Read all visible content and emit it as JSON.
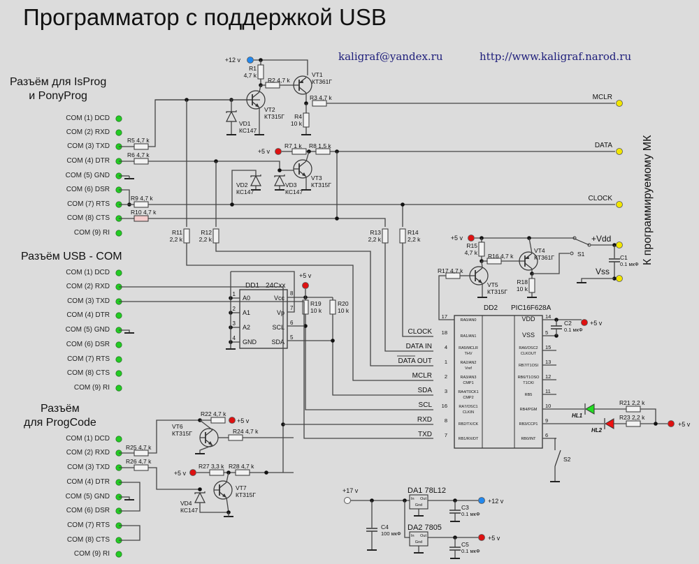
{
  "title": "Программатор с поддержкой USB",
  "email": "kaligraf@yandex.ru",
  "website": "http://www.kaligraf.narod.ru",
  "side_label": "К программируемому МК",
  "connectors": [
    {
      "id": "isprog",
      "title_lines": [
        "Разъём для IsProg",
        "и PonyProg"
      ],
      "pins": [
        "COM (1) DCD",
        "COM (2) RXD",
        "COM (3) TXD",
        "COM (4) DTR",
        "COM (5) GND",
        "COM (6) DSR",
        "COM (7) RTS",
        "COM (8) CTS",
        "COM (9) RI"
      ]
    },
    {
      "id": "usbcom",
      "title_lines": [
        "Разъём USB - COM"
      ],
      "pins": [
        "COM (1) DCD",
        "COM (2) RXD",
        "COM (3) TXD",
        "COM (4) DTR",
        "COM (5) GND",
        "COM (6) DSR",
        "COM (7) RTS",
        "COM (8) CTS",
        "COM (9) RI"
      ]
    },
    {
      "id": "progcode",
      "title_lines": [
        "Разъём",
        "для ProgCode"
      ],
      "pins": [
        "COM (1) DCD",
        "COM (2) RXD",
        "COM (3) TXD",
        "COM (4) DTR",
        "COM (5) GND",
        "COM (6) DSR",
        "COM (7) RTS",
        "COM (8) CTS",
        "COM (9) RI"
      ]
    }
  ],
  "outputs": {
    "mclr": "MCLR",
    "data": "DATA",
    "clock": "CLOCK",
    "vdd": "+Vdd",
    "vss": "Vss"
  },
  "power": {
    "p12": "+12 v",
    "p5": "+5 v",
    "p17": "+17 v"
  },
  "components": {
    "R1": {
      "name": "R1",
      "value": "4,7 k"
    },
    "R2": {
      "name": "R2",
      "value": "4,7 k"
    },
    "R3": {
      "name": "R3",
      "value": "4,7 k"
    },
    "R4": {
      "name": "R4",
      "value": "10 k"
    },
    "R5": {
      "name": "R5",
      "value": "4,7 k"
    },
    "R6": {
      "name": "R6",
      "value": "4,7 k"
    },
    "R7": {
      "name": "R7",
      "value": "1 k"
    },
    "R8": {
      "name": "R8",
      "value": "1,5 k"
    },
    "R9": {
      "name": "R9",
      "value": "4,7 k"
    },
    "R10": {
      "name": "R10",
      "value": "4,7 k"
    },
    "R11": {
      "name": "R11",
      "value": "2,2 k"
    },
    "R12": {
      "name": "R12",
      "value": "2,2 k"
    },
    "R13": {
      "name": "R13",
      "value": "2,2 k"
    },
    "R14": {
      "name": "R14",
      "value": "2,2 k"
    },
    "R15": {
      "name": "R15",
      "value": "4,7 k"
    },
    "R16": {
      "name": "R16",
      "value": "4,7 k"
    },
    "R17": {
      "name": "R17",
      "value": "4,7 k"
    },
    "R18": {
      "name": "R18",
      "value": "10 k"
    },
    "R19": {
      "name": "R19",
      "value": "10 k"
    },
    "R20": {
      "name": "R20",
      "value": "10 k"
    },
    "R21": {
      "name": "R21",
      "value": "2,2 k"
    },
    "R22": {
      "name": "R22",
      "value": "4,7 k"
    },
    "R23": {
      "name": "R23",
      "value": "2,2 k"
    },
    "R24": {
      "name": "R24",
      "value": "4,7 k"
    },
    "R25": {
      "name": "R25",
      "value": "4,7 k"
    },
    "R26": {
      "name": "R26",
      "value": "4,7 k"
    },
    "R27": {
      "name": "R27",
      "value": "3,3 k"
    },
    "R28": {
      "name": "R28",
      "value": "4,7 k"
    },
    "VT1": {
      "name": "VT1",
      "value": "КТ361Г"
    },
    "VT2": {
      "name": "VT2",
      "value": "КТ315Г"
    },
    "VT3": {
      "name": "VT3",
      "value": "КТ315Г"
    },
    "VT4": {
      "name": "VT4",
      "value": "КТ361Г"
    },
    "VT5": {
      "name": "VT5",
      "value": "КТ315Г"
    },
    "VT6": {
      "name": "VT6",
      "value": "КТ315Г"
    },
    "VT7": {
      "name": "VT7",
      "value": "КТ315Г"
    },
    "VD1": {
      "name": "VD1",
      "value": "КС147"
    },
    "VD2": {
      "name": "VD2",
      "value": "КС147"
    },
    "VD3": {
      "name": "VD3",
      "value": "КС147"
    },
    "VD4": {
      "name": "VD4",
      "value": "КС147"
    },
    "C1": {
      "name": "C1",
      "value": "0.1 мкФ"
    },
    "C2": {
      "name": "C2",
      "value": "0.1 мкФ"
    },
    "C3": {
      "name": "C3",
      "value": "0.1 мкФ"
    },
    "C4": {
      "name": "C4",
      "value": "100 мкФ"
    },
    "C5": {
      "name": "C5",
      "value": "0.1 мкФ"
    },
    "HL1": {
      "name": "HL1"
    },
    "HL2": {
      "name": "HL2"
    },
    "S1": {
      "name": "S1"
    },
    "S2": {
      "name": "S2"
    },
    "DA1": {
      "name": "DA1",
      "value": "78L12"
    },
    "DA2": {
      "name": "DA2",
      "value": "7805"
    }
  },
  "dd1": {
    "name": "DD1",
    "part": "24Cxx",
    "left_pins": [
      {
        "n": "1",
        "label": "A0"
      },
      {
        "n": "2",
        "label": "A1"
      },
      {
        "n": "3",
        "label": "A2"
      },
      {
        "n": "4",
        "label": "GND"
      }
    ],
    "right_pins": [
      {
        "n": "8",
        "label": "Vcc"
      },
      {
        "n": "7",
        "label": "Vp"
      },
      {
        "n": "6",
        "label": "SCL"
      },
      {
        "n": "5",
        "label": "SDA"
      }
    ]
  },
  "dd2": {
    "name": "DD2",
    "part": "PIC16F628A",
    "left_pins": [
      {
        "n": "17",
        "label": "RA0/AN0",
        "net": ""
      },
      {
        "n": "18",
        "label": "RA1/AN1",
        "net": "CLOCK"
      },
      {
        "n": "4",
        "label": "RA5/MCLR THV",
        "net": "DATA IN"
      },
      {
        "n": "1",
        "label": "RA2/AN2 Vref",
        "net": "DATA OUT"
      },
      {
        "n": "2",
        "label": "RA3/AN3 CMP1",
        "net": "MCLR"
      },
      {
        "n": "3",
        "label": "RA4/T0CK1 CMP2",
        "net": "SDA"
      },
      {
        "n": "16",
        "label": "RA7/OSC1 CLKIN",
        "net": "SCL"
      },
      {
        "n": "8",
        "label": "RB2/TX/CK",
        "net": "RXD"
      },
      {
        "n": "7",
        "label": "RB1/RX/DT",
        "net": "TXD"
      }
    ],
    "right_pins": [
      {
        "n": "14",
        "label": "VDD"
      },
      {
        "n": "5",
        "label": "VSS"
      },
      {
        "n": "15",
        "label": "RA6/OSC2 CLKOUT"
      },
      {
        "n": "13",
        "label": "RB7/T1OSI"
      },
      {
        "n": "12",
        "label": "RB6/T1OSO T1CKI"
      },
      {
        "n": "11",
        "label": "RB5"
      },
      {
        "n": "10",
        "label": "RB4/PGM"
      },
      {
        "n": "9",
        "label": "RB3/CCP1"
      },
      {
        "n": "6",
        "label": "RB0/INT"
      }
    ]
  },
  "regulator_pins": {
    "in": "In",
    "out": "Out",
    "gnd": "Gnd"
  },
  "colors": {
    "connector_pin": "#22cc22",
    "output_pin": "#f2e600",
    "plus5": "#dd1111",
    "plus12": "#2288ee",
    "led_green": "#22dd22",
    "led_red": "#ee1111",
    "wire": "#444444",
    "link": "#1d1d7a"
  }
}
